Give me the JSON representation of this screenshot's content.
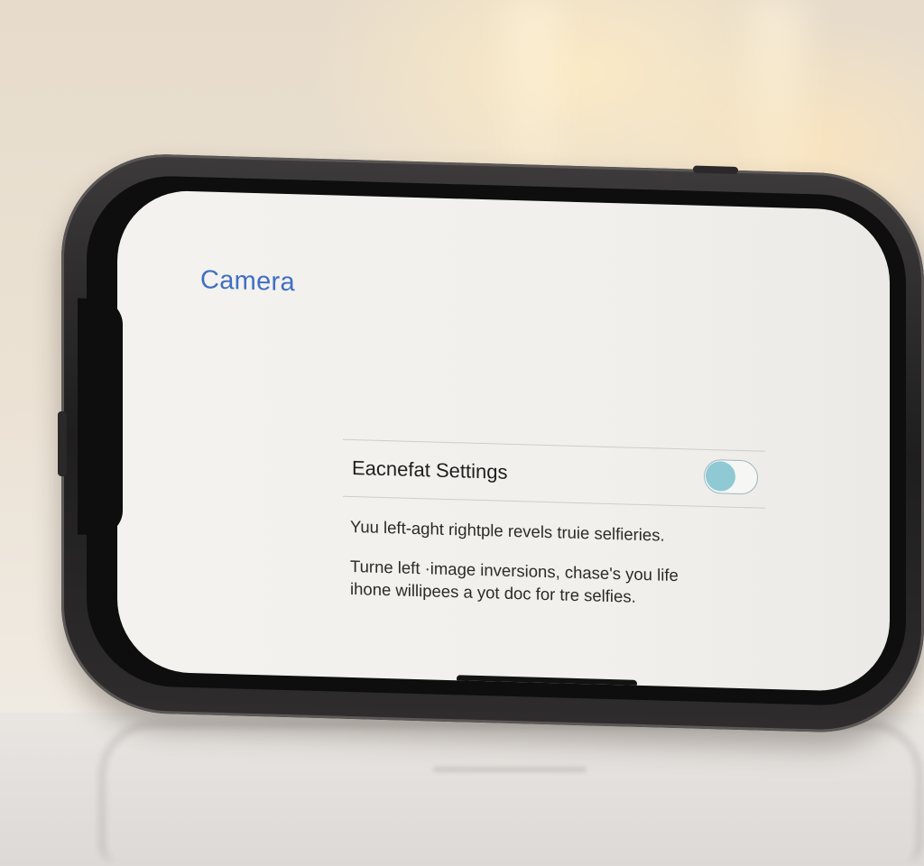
{
  "screen": {
    "back_link": "Camera",
    "setting": {
      "label": "Eacnefat Settings",
      "toggle_state": "on",
      "toggle_color": "#8fc9d3"
    },
    "description_1": "Yuu left-aght rightple revels truie selfieries.",
    "description_2_line_1": "Turne left ·image inversions, chase's you life",
    "description_2_line_2": "ihone willipees a yot doc for tre selfies."
  },
  "colors": {
    "accent": "#3f6fc4",
    "text": "#1e1e1e"
  }
}
